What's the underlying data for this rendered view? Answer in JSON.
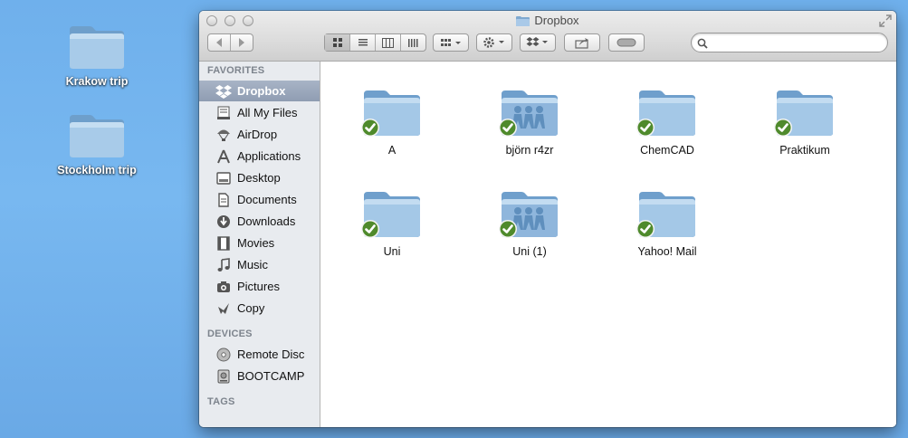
{
  "desktop": {
    "icons": [
      {
        "label": "Krakow trip"
      },
      {
        "label": "Stockholm trip"
      }
    ]
  },
  "window": {
    "title": "Dropbox",
    "search": {
      "placeholder": "",
      "value": ""
    },
    "toolbar": {
      "view_modes": [
        "icon-view",
        "list-view",
        "column-view",
        "cover-flow-view"
      ],
      "active_view": "icon-view"
    }
  },
  "sidebar": {
    "favorites_header": "FAVORITES",
    "favorites": [
      {
        "label": "Dropbox",
        "icon": "dropbox-icon",
        "selected": true
      },
      {
        "label": "All My Files",
        "icon": "all-files-icon"
      },
      {
        "label": "AirDrop",
        "icon": "airdrop-icon"
      },
      {
        "label": "Applications",
        "icon": "applications-icon"
      },
      {
        "label": "Desktop",
        "icon": "desktop-icon"
      },
      {
        "label": "Documents",
        "icon": "documents-icon"
      },
      {
        "label": "Downloads",
        "icon": "downloads-icon"
      },
      {
        "label": "Movies",
        "icon": "movies-icon"
      },
      {
        "label": "Music",
        "icon": "music-icon"
      },
      {
        "label": "Pictures",
        "icon": "pictures-icon"
      },
      {
        "label": "Copy",
        "icon": "copy-icon"
      }
    ],
    "devices_header": "DEVICES",
    "devices": [
      {
        "label": "Remote Disc",
        "icon": "disc-icon"
      },
      {
        "label": "BOOTCAMP",
        "icon": "drive-icon"
      }
    ],
    "tags_header": "TAGS"
  },
  "content": {
    "items": [
      {
        "label": "A",
        "shared": false,
        "synced": true
      },
      {
        "label": "björn r4zr",
        "shared": true,
        "synced": true
      },
      {
        "label": "ChemCAD",
        "shared": false,
        "synced": true
      },
      {
        "label": "Praktikum",
        "shared": false,
        "synced": true
      },
      {
        "label": "Uni",
        "shared": false,
        "synced": true
      },
      {
        "label": "Uni (1)",
        "shared": true,
        "synced": true
      },
      {
        "label": "Yahoo! Mail",
        "shared": false,
        "synced": true
      }
    ]
  },
  "colors": {
    "folder": "#7fb0dc",
    "sync_check": "#4f8a2c",
    "sidebar_selection": "#98a6bb"
  }
}
